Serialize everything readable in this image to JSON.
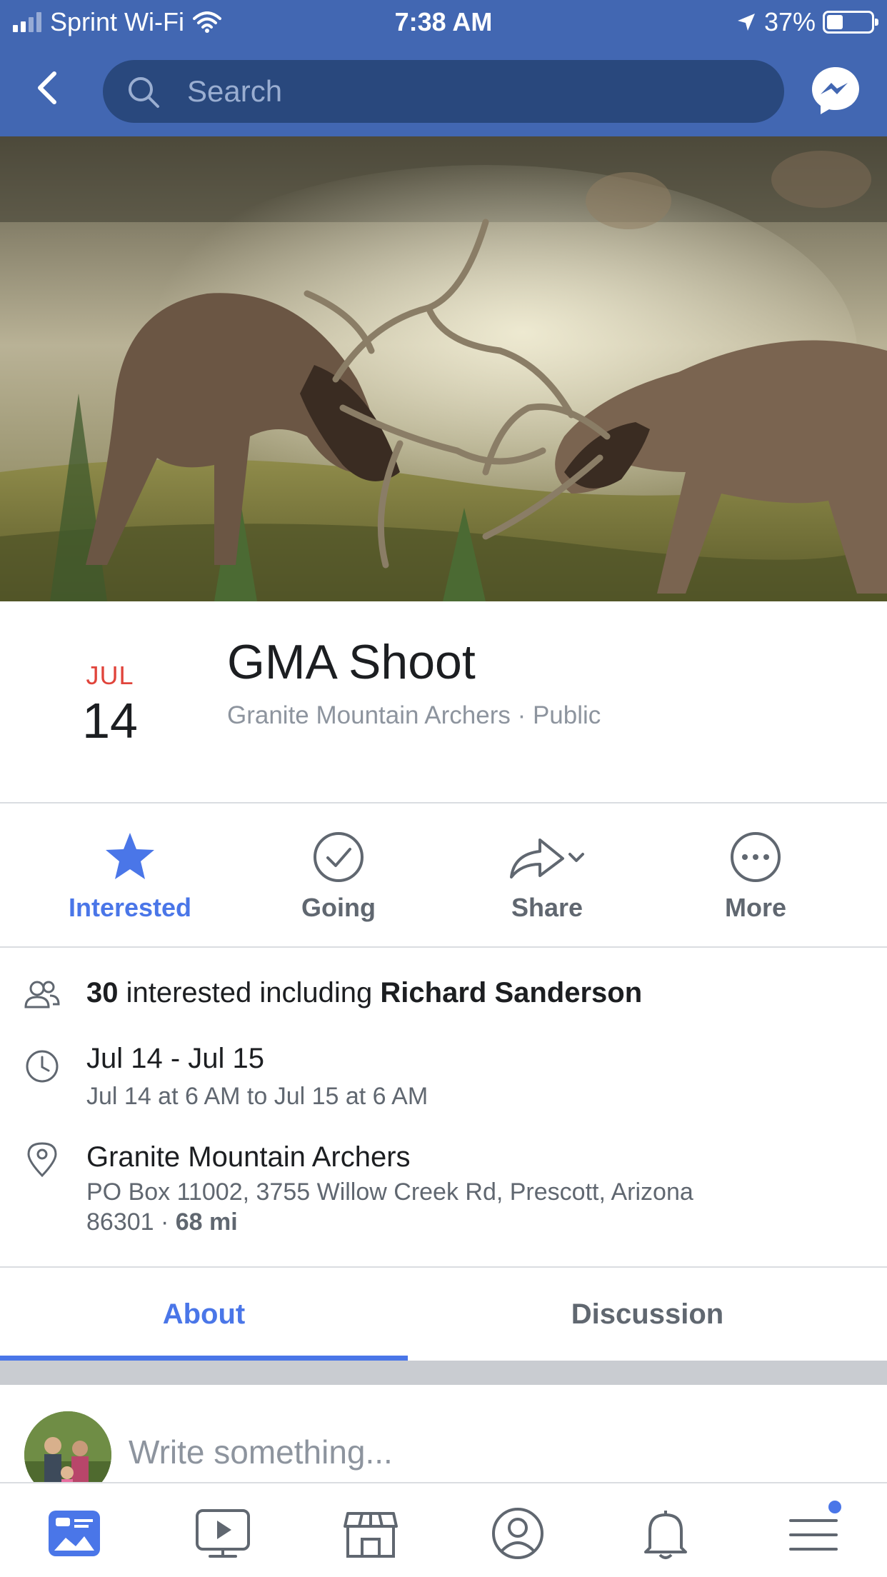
{
  "status_bar": {
    "carrier": "Sprint Wi-Fi",
    "time": "7:38 AM",
    "battery": "37%"
  },
  "nav": {
    "search_placeholder": "Search"
  },
  "event": {
    "month": "JUL",
    "day": "14",
    "title": "GMA Shoot",
    "subtitle": "Granite Mountain Archers · Public"
  },
  "actions": [
    {
      "label": "Interested",
      "active": true
    },
    {
      "label": "Going",
      "active": false
    },
    {
      "label": "Share",
      "active": false
    },
    {
      "label": "More",
      "active": false
    }
  ],
  "info": {
    "interested_count": "30",
    "interested_text": " interested including ",
    "interested_name": "Richard Sanderson",
    "date_range": "Jul 14 - Jul 15",
    "time_detail": "Jul 14 at 6 AM to Jul 15 at 6 AM",
    "location_name": "Granite Mountain Archers",
    "address_line1": "PO Box 11002, 3755 Willow Creek Rd, Prescott, Arizona",
    "address_zip": "86301 · ",
    "distance": "68 mi"
  },
  "tabs": {
    "about": "About",
    "discussion": "Discussion"
  },
  "composer": {
    "placeholder": "Write something..."
  },
  "colors": {
    "brand_blue": "#4267b2",
    "accent_blue": "#4a76e8",
    "date_red": "#e0443b"
  },
  "bottom_nav": [
    "news-feed-icon",
    "watch-icon",
    "marketplace-icon",
    "profile-icon",
    "notifications-icon",
    "menu-icon"
  ]
}
